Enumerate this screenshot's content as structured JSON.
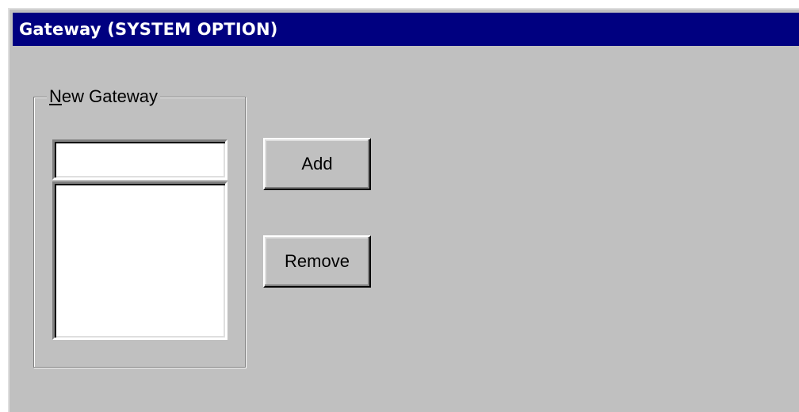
{
  "window": {
    "title": "Gateway (SYSTEM OPTION)"
  },
  "group": {
    "label_accel": "N",
    "label_rest": "ew Gateway"
  },
  "new_gateway_input": {
    "value": ""
  },
  "gateway_list": {
    "items": []
  },
  "buttons": {
    "add_label": "Add",
    "remove_label": "Remove"
  },
  "colors": {
    "titlebar": "#000080",
    "titlebar_text": "#ffffff",
    "face": "#c0c0c0",
    "field": "#ffffff"
  }
}
